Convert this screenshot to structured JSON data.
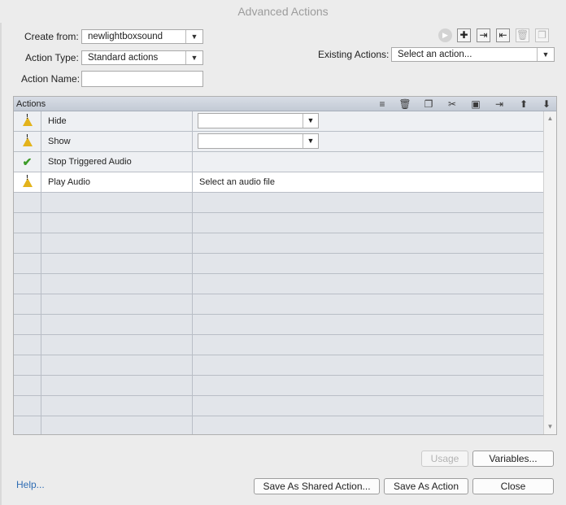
{
  "window": {
    "title": "Advanced Actions"
  },
  "form": {
    "create_from_label": "Create from:",
    "create_from_value": "newlightboxsound",
    "action_type_label": "Action Type:",
    "action_type_value": "Standard actions",
    "action_name_label": "Action Name:",
    "action_name_value": "",
    "existing_actions_label": "Existing Actions:",
    "existing_actions_value": "Select an action..."
  },
  "toolbar": {
    "icons": [
      "play-icon",
      "add-icon",
      "import-icon",
      "export-icon",
      "delete-icon",
      "duplicate-icon"
    ]
  },
  "grid": {
    "header_title": "Actions",
    "header_icons": [
      "insert-row-icon",
      "trash-icon",
      "copy-icon",
      "cut-icon",
      "paste-icon",
      "indent-icon",
      "move-up-icon",
      "move-down-icon"
    ],
    "rows": [
      {
        "status": "warning",
        "action": "Hide",
        "target": ""
      },
      {
        "status": "warning",
        "action": "Show",
        "target": ""
      },
      {
        "status": "ok",
        "action": "Stop Triggered Audio",
        "target": ""
      },
      {
        "status": "warning",
        "action": "Play Audio",
        "target": "Select an audio file"
      }
    ]
  },
  "buttons": {
    "usage": "Usage",
    "variables": "Variables...",
    "save_shared": "Save As Shared Action...",
    "save_action": "Save As Action",
    "close": "Close",
    "help": "Help..."
  },
  "colors": {
    "accent_link": "#2f6db4",
    "warning": "#e3b31c",
    "ok": "#3c9b28"
  }
}
